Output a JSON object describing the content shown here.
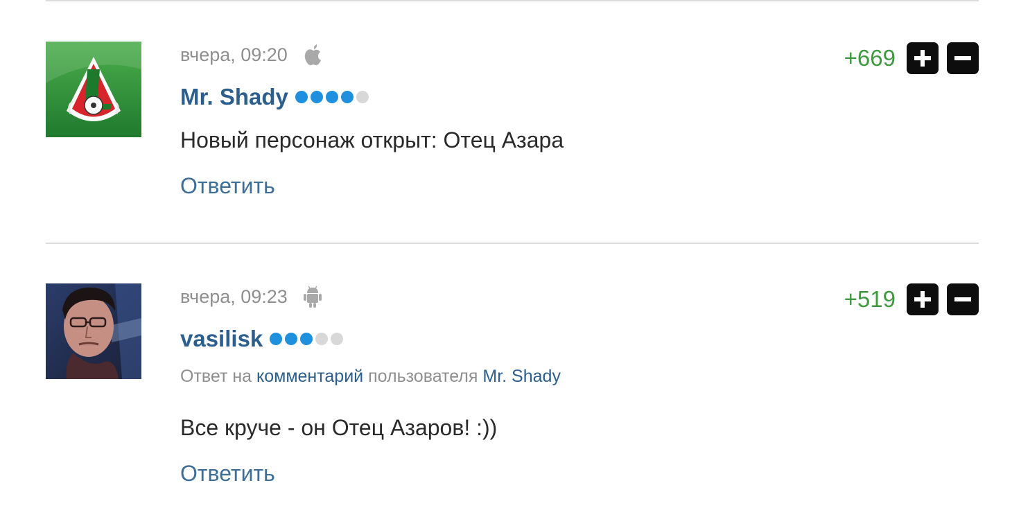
{
  "comments": [
    {
      "time": "вчера, 09:20",
      "platform_icon": "apple-icon",
      "author": "Mr. Shady",
      "rating_dots": 4,
      "rating_max": 5,
      "reply_to": null,
      "text": "Новый персонаж открыт: Отец Азара",
      "reply_label": "Ответить",
      "score": "+669",
      "avatar": "lokomotiv-logo"
    },
    {
      "time": "вчера, 09:23",
      "platform_icon": "android-icon",
      "author": "vasilisk",
      "rating_dots": 3,
      "rating_max": 5,
      "reply_to": {
        "prefix": "Ответ на",
        "link": "комментарий",
        "middle": "пользователя",
        "user": "Mr. Shady"
      },
      "text": "Все круче - он Отец Азаров! :))",
      "reply_label": "Ответить",
      "score": "+519",
      "avatar": "user-portrait"
    }
  ],
  "colors": {
    "author": "#2c5f8d",
    "link": "#3d6e98",
    "score_positive": "#3f9a3f",
    "rating_on": "#1e90dd",
    "rating_off": "#d8d8d8",
    "vote_button": "#0d0d0d"
  }
}
